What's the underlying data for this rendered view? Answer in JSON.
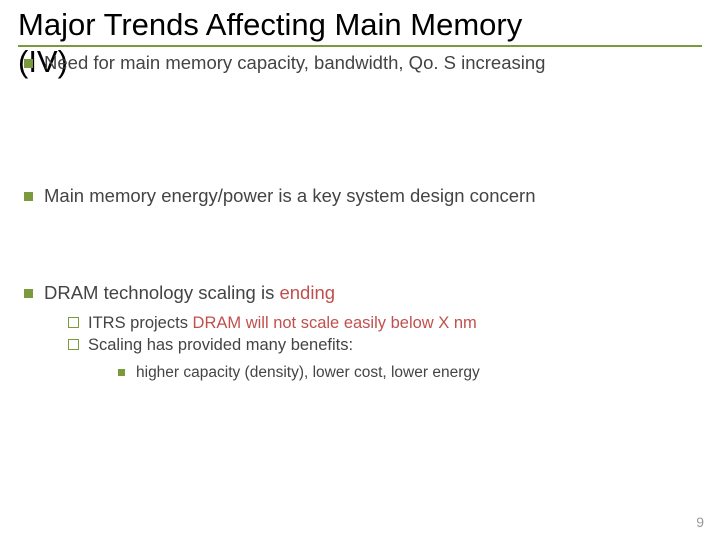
{
  "title_line1": "Major Trends Affecting Main Memory",
  "title_line2": "(IV)",
  "bullets": {
    "b1": "Need for main memory capacity, bandwidth, Qo. S increasing",
    "b2": "Main memory energy/power is a key system design concern",
    "b3_pre": "DRAM technology scaling is ",
    "b3_em": "ending",
    "sub1_pre": "ITRS projects ",
    "sub1_em": "DRAM will not scale easily below X nm",
    "sub2": "Scaling has provided many benefits:",
    "sub2a": "higher capacity (density), lower cost, lower energy"
  },
  "pagenum": "9"
}
